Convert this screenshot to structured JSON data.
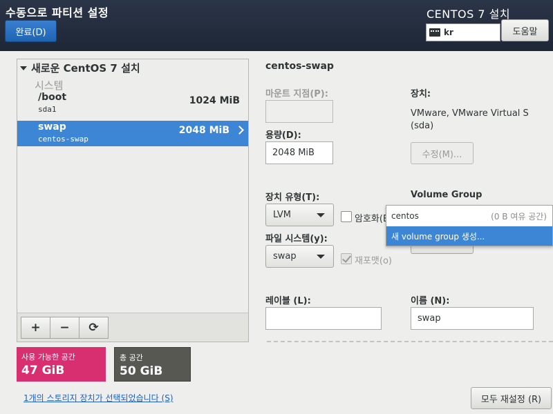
{
  "header": {
    "page_title": "수동으로 파티션 설정",
    "done_button": "완료(D)",
    "install_title": "CENTOS 7 설치",
    "keyboard_layout": "kr",
    "help_button": "도움말"
  },
  "left": {
    "tree_header": "새로운 CentOS 7 설치",
    "section": "시스템",
    "entries": [
      {
        "name": "/boot",
        "device": "sda1",
        "size": "1024 MiB",
        "selected": false
      },
      {
        "name": "swap",
        "device": "centos-swap",
        "size": "2048 MiB",
        "selected": true
      }
    ],
    "toolbar": {
      "add": "+",
      "remove": "−",
      "refresh": "⟳"
    }
  },
  "space": {
    "available_label": "사용 가능한 공간",
    "available_value": "47 GiB",
    "total_label": "총 공간",
    "total_value": "50 GiB"
  },
  "storage_link": "1개의 스토리지 장치가 선택되었습니다 (S)",
  "details": {
    "title": "centos-swap",
    "mount_point_label": "마운트 지점(P):",
    "mount_point_value": "",
    "capacity_label": "용량(D):",
    "capacity_value": "2048 MiB",
    "device_label": "장치:",
    "device_value_line1": "VMware, VMware Virtual S",
    "device_value_line2": "(sda)",
    "modify_button": "수정(M)...",
    "device_type_label": "장치 유형(T):",
    "device_type_value": "LVM",
    "encrypt_label": "암호화(E",
    "encrypt_checked": false,
    "filesystem_label": "파일 시스템(y):",
    "filesystem_value": "swap",
    "reformat_label": "재포맷(o)",
    "reformat_checked": true,
    "volume_group_label": "Volume Group",
    "volume_group_options": [
      {
        "name": "centos",
        "extra": "(0 B 여유 공간)"
      },
      {
        "name": "새 volume group 생성...",
        "extra": ""
      }
    ],
    "label_label": "레이블 (L):",
    "label_value": "",
    "name_label": "이름 (N):",
    "name_value": "swap"
  },
  "reset_button": "모두 재설정 (R)",
  "colors": {
    "selected_blue": "#3d86d5",
    "available_pink": "#d72f6f",
    "total_gray": "#585852"
  }
}
